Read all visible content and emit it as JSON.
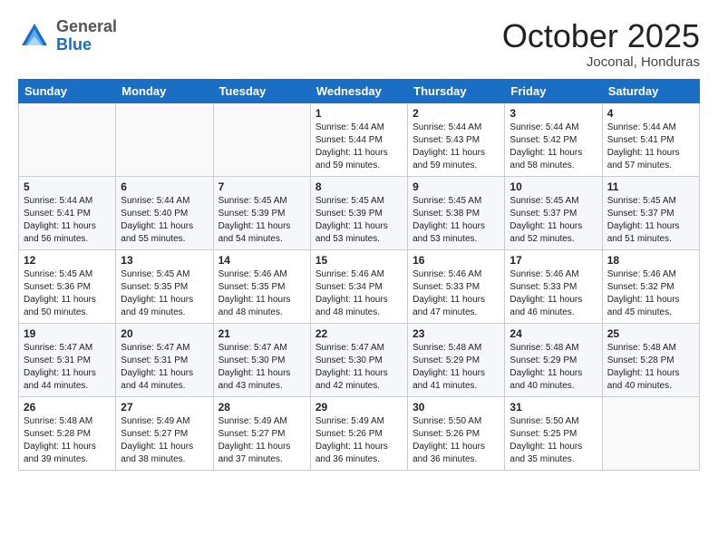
{
  "header": {
    "logo_general": "General",
    "logo_blue": "Blue",
    "month": "October 2025",
    "location": "Joconal, Honduras"
  },
  "weekdays": [
    "Sunday",
    "Monday",
    "Tuesday",
    "Wednesday",
    "Thursday",
    "Friday",
    "Saturday"
  ],
  "weeks": [
    [
      {
        "day": "",
        "detail": ""
      },
      {
        "day": "",
        "detail": ""
      },
      {
        "day": "",
        "detail": ""
      },
      {
        "day": "1",
        "detail": "Sunrise: 5:44 AM\nSunset: 5:44 PM\nDaylight: 11 hours\nand 59 minutes."
      },
      {
        "day": "2",
        "detail": "Sunrise: 5:44 AM\nSunset: 5:43 PM\nDaylight: 11 hours\nand 59 minutes."
      },
      {
        "day": "3",
        "detail": "Sunrise: 5:44 AM\nSunset: 5:42 PM\nDaylight: 11 hours\nand 58 minutes."
      },
      {
        "day": "4",
        "detail": "Sunrise: 5:44 AM\nSunset: 5:41 PM\nDaylight: 11 hours\nand 57 minutes."
      }
    ],
    [
      {
        "day": "5",
        "detail": "Sunrise: 5:44 AM\nSunset: 5:41 PM\nDaylight: 11 hours\nand 56 minutes."
      },
      {
        "day": "6",
        "detail": "Sunrise: 5:44 AM\nSunset: 5:40 PM\nDaylight: 11 hours\nand 55 minutes."
      },
      {
        "day": "7",
        "detail": "Sunrise: 5:45 AM\nSunset: 5:39 PM\nDaylight: 11 hours\nand 54 minutes."
      },
      {
        "day": "8",
        "detail": "Sunrise: 5:45 AM\nSunset: 5:39 PM\nDaylight: 11 hours\nand 53 minutes."
      },
      {
        "day": "9",
        "detail": "Sunrise: 5:45 AM\nSunset: 5:38 PM\nDaylight: 11 hours\nand 53 minutes."
      },
      {
        "day": "10",
        "detail": "Sunrise: 5:45 AM\nSunset: 5:37 PM\nDaylight: 11 hours\nand 52 minutes."
      },
      {
        "day": "11",
        "detail": "Sunrise: 5:45 AM\nSunset: 5:37 PM\nDaylight: 11 hours\nand 51 minutes."
      }
    ],
    [
      {
        "day": "12",
        "detail": "Sunrise: 5:45 AM\nSunset: 5:36 PM\nDaylight: 11 hours\nand 50 minutes."
      },
      {
        "day": "13",
        "detail": "Sunrise: 5:45 AM\nSunset: 5:35 PM\nDaylight: 11 hours\nand 49 minutes."
      },
      {
        "day": "14",
        "detail": "Sunrise: 5:46 AM\nSunset: 5:35 PM\nDaylight: 11 hours\nand 48 minutes."
      },
      {
        "day": "15",
        "detail": "Sunrise: 5:46 AM\nSunset: 5:34 PM\nDaylight: 11 hours\nand 48 minutes."
      },
      {
        "day": "16",
        "detail": "Sunrise: 5:46 AM\nSunset: 5:33 PM\nDaylight: 11 hours\nand 47 minutes."
      },
      {
        "day": "17",
        "detail": "Sunrise: 5:46 AM\nSunset: 5:33 PM\nDaylight: 11 hours\nand 46 minutes."
      },
      {
        "day": "18",
        "detail": "Sunrise: 5:46 AM\nSunset: 5:32 PM\nDaylight: 11 hours\nand 45 minutes."
      }
    ],
    [
      {
        "day": "19",
        "detail": "Sunrise: 5:47 AM\nSunset: 5:31 PM\nDaylight: 11 hours\nand 44 minutes."
      },
      {
        "day": "20",
        "detail": "Sunrise: 5:47 AM\nSunset: 5:31 PM\nDaylight: 11 hours\nand 44 minutes."
      },
      {
        "day": "21",
        "detail": "Sunrise: 5:47 AM\nSunset: 5:30 PM\nDaylight: 11 hours\nand 43 minutes."
      },
      {
        "day": "22",
        "detail": "Sunrise: 5:47 AM\nSunset: 5:30 PM\nDaylight: 11 hours\nand 42 minutes."
      },
      {
        "day": "23",
        "detail": "Sunrise: 5:48 AM\nSunset: 5:29 PM\nDaylight: 11 hours\nand 41 minutes."
      },
      {
        "day": "24",
        "detail": "Sunrise: 5:48 AM\nSunset: 5:29 PM\nDaylight: 11 hours\nand 40 minutes."
      },
      {
        "day": "25",
        "detail": "Sunrise: 5:48 AM\nSunset: 5:28 PM\nDaylight: 11 hours\nand 40 minutes."
      }
    ],
    [
      {
        "day": "26",
        "detail": "Sunrise: 5:48 AM\nSunset: 5:28 PM\nDaylight: 11 hours\nand 39 minutes."
      },
      {
        "day": "27",
        "detail": "Sunrise: 5:49 AM\nSunset: 5:27 PM\nDaylight: 11 hours\nand 38 minutes."
      },
      {
        "day": "28",
        "detail": "Sunrise: 5:49 AM\nSunset: 5:27 PM\nDaylight: 11 hours\nand 37 minutes."
      },
      {
        "day": "29",
        "detail": "Sunrise: 5:49 AM\nSunset: 5:26 PM\nDaylight: 11 hours\nand 36 minutes."
      },
      {
        "day": "30",
        "detail": "Sunrise: 5:50 AM\nSunset: 5:26 PM\nDaylight: 11 hours\nand 36 minutes."
      },
      {
        "day": "31",
        "detail": "Sunrise: 5:50 AM\nSunset: 5:25 PM\nDaylight: 11 hours\nand 35 minutes."
      },
      {
        "day": "",
        "detail": ""
      }
    ]
  ]
}
